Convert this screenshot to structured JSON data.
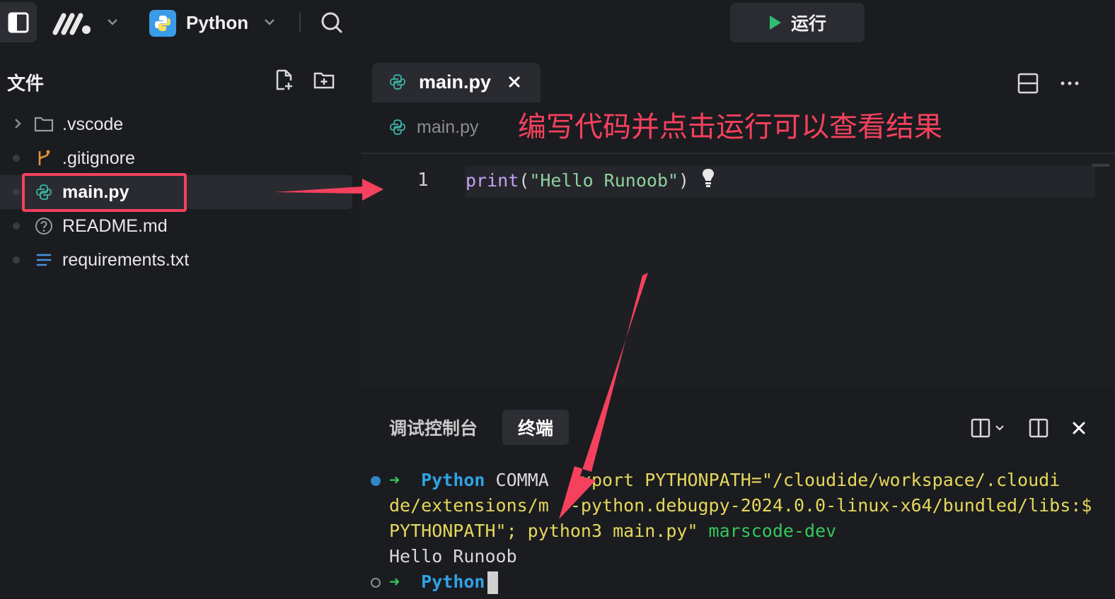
{
  "topbar": {
    "project_name": "Python",
    "run_label": "运行"
  },
  "sidebar": {
    "title": "文件",
    "items": [
      {
        "label": ".vscode",
        "type": "folder"
      },
      {
        "label": ".gitignore",
        "type": "git"
      },
      {
        "label": "main.py",
        "type": "python",
        "selected": true
      },
      {
        "label": "README.md",
        "type": "unknown"
      },
      {
        "label": "requirements.txt",
        "type": "text"
      }
    ]
  },
  "editor": {
    "tab_label": "main.py",
    "breadcrumb": "main.py",
    "annotation": "编写代码并点击运行可以查看结果",
    "line_number": "1",
    "code": {
      "fn": "print",
      "open": "(",
      "str": "\"Hello Runoob\"",
      "close": ")"
    }
  },
  "panel": {
    "tabs": [
      "调试控制台",
      "终端"
    ],
    "active_tab": "终端",
    "terminal": {
      "l1_arrow": "➜",
      "l1_py": "Python",
      "l1_a": " COMMA",
      "l1_b": "  export PYTHONPATH=\"/cloudide/workspace/.cloudi",
      "l2": "de/extensions/m  -python.debugpy-2024.0.0-linux-x64/bundled/libs:$",
      "l3_a": "PYTHONPATH\"; py",
      "l3_b": "thon3 main.py\"",
      "l3_c": " marscode-dev",
      "l4": "Hello Runoob",
      "l5_arrow": "➜",
      "l5_py": "Python"
    }
  },
  "colors": {
    "accent_red": "#f5415d",
    "run_green": "#2fbf71",
    "python_blue": "#3a9be8"
  }
}
